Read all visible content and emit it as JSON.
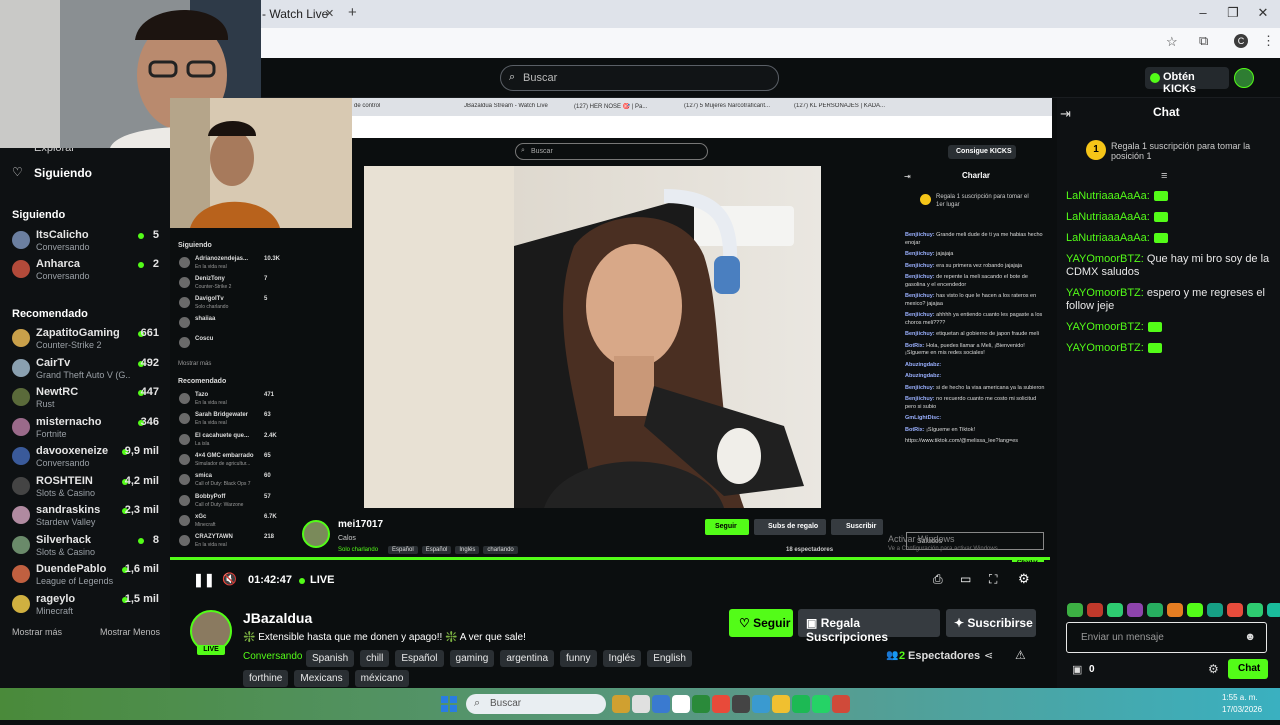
{
  "browser": {
    "tab_title": "- Watch Live",
    "new_tab": "+",
    "window_min": "–",
    "window_max": "❐",
    "window_close": "✕",
    "profile_letter": "C"
  },
  "header": {
    "search_placeholder": "Buscar",
    "kicks_button": "Obtén KICKs"
  },
  "sidebar": {
    "explore": "Explorar",
    "following_nav": "Siguiendo",
    "following_title": "Siguiendo",
    "following": [
      {
        "name": "ItsCalicho",
        "sub": "Conversando",
        "count": "5",
        "color": "#6b7fa0"
      },
      {
        "name": "Anharca",
        "sub": "Conversando",
        "count": "2",
        "color": "#b24a3a"
      }
    ],
    "recommended_title": "Recomendado",
    "recommended": [
      {
        "name": "ZapatitoGaming",
        "sub": "Counter-Strike 2",
        "count": "661",
        "color": "#c9a04a"
      },
      {
        "name": "CairTv",
        "sub": "Grand Theft Auto V (G...",
        "count": "492",
        "color": "#8aa0b0"
      },
      {
        "name": "NewtRC",
        "sub": "Rust",
        "count": "447",
        "color": "#5a6a3a"
      },
      {
        "name": "misternacho",
        "sub": "Fortnite",
        "count": "346",
        "color": "#9a6a8a"
      },
      {
        "name": "davooxeneize",
        "sub": "Conversando",
        "count": "9,9 mil",
        "color": "#3a5a9a"
      },
      {
        "name": "ROSHTEIN",
        "sub": "Slots & Casino",
        "count": "4,2 mil",
        "color": "#444"
      },
      {
        "name": "sandraskins",
        "sub": "Stardew Valley",
        "count": "2,3 mil",
        "color": "#b08aa0"
      },
      {
        "name": "Silverhack",
        "sub": "Slots & Casino",
        "count": "8",
        "color": "#6a8a6a"
      },
      {
        "name": "DuendePablo",
        "sub": "League of Legends",
        "count": "1,6 mil",
        "color": "#c06040"
      },
      {
        "name": "rageylo",
        "sub": "Minecraft",
        "count": "1,5 mil",
        "color": "#d0b040"
      }
    ],
    "show_more": "Mostrar más",
    "show_less": "Mostrar Menos"
  },
  "inner": {
    "search": "Buscar",
    "kicks": "Consigue KICKS",
    "tabs": [
      "de control",
      "JBazaldua Stream - Watch Live",
      "(127) HER NOSE 🎯 | Pa...",
      "(127) 5 Mujeres Narcotraficant...",
      "(127) KL PERSONAJES | KADA..."
    ],
    "sidebar_following_title": "Siguiendo",
    "sidebar_following": [
      {
        "name": "Adrianozendejas...",
        "sub": "En la vida real",
        "count": "10.3K"
      },
      {
        "name": "DenizTony",
        "sub": "Counter-Strike 2",
        "count": "7"
      },
      {
        "name": "DavigolTv",
        "sub": "Solo charlando",
        "count": "5"
      },
      {
        "name": "shaiiaa",
        "sub": "",
        "count": ""
      },
      {
        "name": "Coscu",
        "sub": "",
        "count": ""
      }
    ],
    "show_more": "Mostrar más",
    "sidebar_recommended_title": "Recomendado",
    "sidebar_recommended": [
      {
        "name": "Tazo",
        "sub": "En la vida real",
        "count": "471"
      },
      {
        "name": "Sarah Bridgewater",
        "sub": "En la vida real",
        "count": "63"
      },
      {
        "name": "El cacahuete que...",
        "sub": "La isla",
        "count": "2.4K"
      },
      {
        "name": "4×4 GMC embarrado",
        "sub": "Simulador de agricultur...",
        "count": "65"
      },
      {
        "name": "smica",
        "sub": "Call of Duty: Black Ops 7",
        "count": "60"
      },
      {
        "name": "BobbyPoff",
        "sub": "Call of Duty: Warzone",
        "count": "57"
      },
      {
        "name": "xGc",
        "sub": "Minecraft",
        "count": "6.7K"
      },
      {
        "name": "CRAZYTAWN",
        "sub": "En la vida real",
        "count": "218"
      }
    ],
    "chat_title": "Charlar",
    "pinned": "Regala 1 suscripción para tomar el 1er lugar",
    "messages": [
      {
        "user": "Benjiichuy:",
        "text": "Grande meli dude de ti ya me habias hecho enojar"
      },
      {
        "user": "Benjiichuy:",
        "text": "jajajaja"
      },
      {
        "user": "Benjiichuy:",
        "text": "era su primera vez robando jajajaja"
      },
      {
        "user": "Benjiichuy:",
        "text": "de repente la meli sacando el bote de gasolina y el encendedor"
      },
      {
        "user": "Benjiichuy:",
        "text": "has visto lo que le hacen a los rateros en mexico? jajajaa"
      },
      {
        "user": "Benjiichuy:",
        "text": "ahhhh ya entiendo cuanto les pagaste a los choros meli????"
      },
      {
        "user": "Benjiichuy:",
        "text": "etiquetan al gobierno de japon fraude meli"
      },
      {
        "user": "BotRix:",
        "text": "Hola, puedes llamar a Meli, ¡Bienvenido! ¡Sígueme en mis redes sociales!"
      },
      {
        "user": "Abuzingdabz:",
        "text": ""
      },
      {
        "user": "Abuzingdabz:",
        "text": ""
      },
      {
        "user": "Benjiichuy:",
        "text": "si de hecho la visa americana ya la subieron"
      },
      {
        "user": "Benjiichuy:",
        "text": "no recuerdo cuanto me costo mi solicitud pero si subio"
      },
      {
        "user": "GmLightDisc:",
        "text": ""
      },
      {
        "user": "BotRix:",
        "text": "¡Sígueme en Tiktok!"
      },
      {
        "user": "",
        "text": "https://www.tiktok.com/@melissa_lee?lang=es"
      }
    ],
    "streamer": "mei17017",
    "title": "Calos",
    "category": "Solo charlando",
    "tags": [
      "Español",
      "Español",
      "Inglés",
      "charlando"
    ],
    "follow": "Seguir",
    "gift": "Subs de regalo",
    "subscribe": "Suscribir",
    "viewers": "18 espectadores",
    "chat_btn": "Charlar",
    "send_placeholder": "Saludos",
    "activate_windows": "Activar Windows",
    "activate_windows_sub": "Ve a Configuración para activar Windows."
  },
  "player": {
    "time": "01:42:47",
    "live": "LIVE"
  },
  "stream": {
    "channel": "JBazaldua",
    "title": "❇️ Extensible hasta que me donen y apago!! ❇️ A ver que sale!",
    "category": "Conversando",
    "tags": [
      "Spanish",
      "chill",
      "Español",
      "gaming",
      "argentina",
      "funny",
      "Inglés",
      "English"
    ],
    "tags2": [
      "forthine",
      "Mexicans",
      "méxicano"
    ],
    "live_badge": "LIVE",
    "follow": "Seguir",
    "gift": "Regala Suscripciones",
    "subscribe": "Suscribirse",
    "viewers_count": "2",
    "viewers_label": "Espectadores"
  },
  "chat": {
    "title": "Chat",
    "pinned": "Regala 1 suscripción para tomar la posición 1",
    "pinned_rank": "1",
    "messages": [
      {
        "user": "LaNutriaaaAaAa:",
        "text": ""
      },
      {
        "user": "LaNutriaaaAaAa:",
        "text": ""
      },
      {
        "user": "LaNutriaaaAaAa:",
        "text": ""
      },
      {
        "user": "YAYOmoorBTZ:",
        "text": "Que hay mi bro soy de la CDMX saludos"
      },
      {
        "user": "YAYOmoorBTZ:",
        "text": "espero y me regreses el follow jeje"
      },
      {
        "user": "YAYOmoorBTZ:",
        "text": ""
      },
      {
        "user": "YAYOmoorBTZ:",
        "text": ""
      }
    ],
    "input_placeholder": "Enviar un mensaje",
    "kicks_count": "0",
    "chat_button": "Chat"
  },
  "taskbar": {
    "search": "Buscar",
    "time": "1:55 a. m.",
    "date": "17/03/2026"
  },
  "colors": {
    "accent": "#53fc18",
    "username": "#53fc18",
    "background": "#0b0e0f"
  }
}
